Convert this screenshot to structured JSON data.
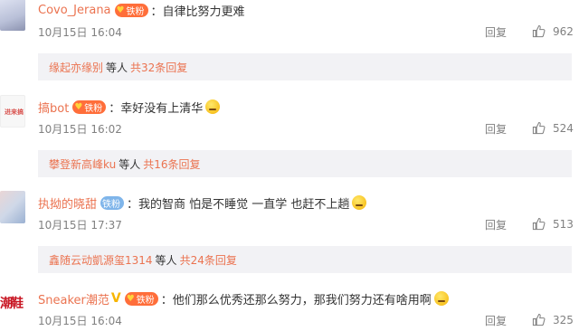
{
  "comments": [
    {
      "username": "Covo_Jerana",
      "badge": "铁粉",
      "text": "自律比努力更难",
      "time": "10月15日 16:04",
      "reply_label": "回复",
      "likes": "962",
      "sub_users": "缘起亦缘别",
      "sub_etc": "等人",
      "sub_more": "共32条回复"
    },
    {
      "username": "搞bot",
      "avatar_text": "进来搞",
      "badge": "铁粉",
      "text": "幸好没有上清华",
      "time": "10月15日 16:02",
      "reply_label": "回复",
      "likes": "524",
      "sub_users": "攀登新高峰ku",
      "sub_etc": "等人",
      "sub_more": "共16条回复"
    },
    {
      "username": "执拗的晓甜",
      "badge": "铁粉",
      "text": "我的智商 怕是不睡觉 一直学 也赶不上趟",
      "time": "10月15日 17:37",
      "reply_label": "回复",
      "likes": "513",
      "sub_users": "鑫随云动凱源玺1314",
      "sub_etc": "等人",
      "sub_more": "共24条回复"
    },
    {
      "username": "Sneaker潮范",
      "avatar_text": "潮鞋",
      "verified": "V",
      "badge": "铁粉",
      "text": "他们那么优秀还那么努力，那我们努力还有啥用啊",
      "time": "10月15日 16:04",
      "reply_label": "回复",
      "likes": "325"
    }
  ],
  "colors": {
    "username": "#eb7350",
    "badge_orange": "#ff6e3a",
    "badge_blue": "#7fb5ea",
    "sub_bg": "#f2f2f5"
  },
  "icons": [
    "thumbs-up-icon",
    "emoji-icon",
    "verified-v-icon",
    "heart-icon"
  ]
}
